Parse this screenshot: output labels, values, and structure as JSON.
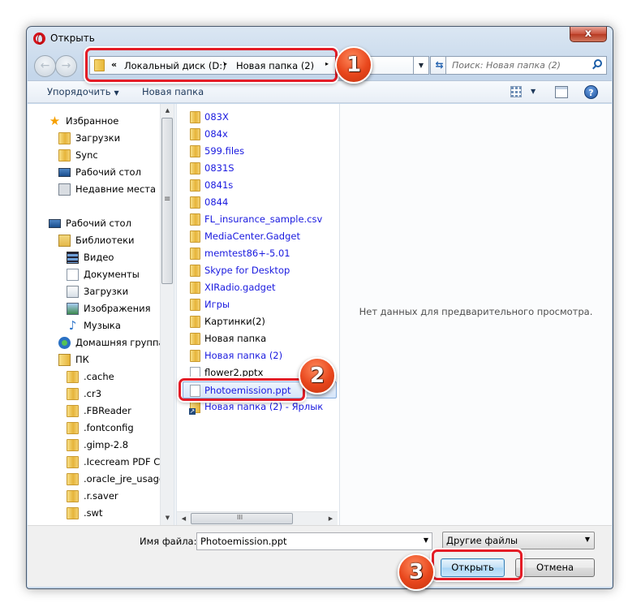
{
  "window": {
    "title": "Открыть",
    "close_label": "x"
  },
  "address_bar": {
    "overflow_chevron": "«",
    "crumbs": [
      "Локальный диск (D:)",
      "Новая папка (2)"
    ],
    "crumb_separator": "▸"
  },
  "search": {
    "placeholder": "Поиск: Новая папка (2)"
  },
  "toolbar": {
    "organize_label": "Упорядочить",
    "new_folder_label": "Новая папка",
    "dropdown_glyph": "▼",
    "help_glyph": "?"
  },
  "nav_pane": {
    "items": [
      {
        "label": "Избранное",
        "icon": "star-icon"
      },
      {
        "label": "Загрузки",
        "icon": "downloads-folder-icon"
      },
      {
        "label": "Sync",
        "icon": "folder-icon"
      },
      {
        "label": "Рабочий стол",
        "icon": "desktop-icon"
      },
      {
        "label": "Недавние места",
        "icon": "recent-places-icon"
      },
      {
        "label": "Рабочий стол",
        "icon": "desktop-icon"
      },
      {
        "label": "Библиотеки",
        "icon": "libraries-icon"
      },
      {
        "label": "Видео",
        "icon": "video-library-icon"
      },
      {
        "label": "Документы",
        "icon": "documents-library-icon"
      },
      {
        "label": "Загрузки",
        "icon": "downloads-library-icon"
      },
      {
        "label": "Изображения",
        "icon": "pictures-library-icon"
      },
      {
        "label": "Музыка",
        "icon": "music-library-icon"
      },
      {
        "label": "Домашняя группа",
        "icon": "homegroup-icon"
      },
      {
        "label": "ПК",
        "icon": "user-folder-icon"
      },
      {
        "label": ".cache",
        "icon": "folder-icon"
      },
      {
        "label": ".cr3",
        "icon": "folder-icon"
      },
      {
        "label": ".FBReader",
        "icon": "folder-icon"
      },
      {
        "label": ".fontconfig",
        "icon": "folder-icon"
      },
      {
        "label": ".gimp-2.8",
        "icon": "folder-icon"
      },
      {
        "label": ".Icecream PDF Co",
        "icon": "folder-icon"
      },
      {
        "label": ".oracle_jre_usage",
        "icon": "folder-icon"
      },
      {
        "label": ".r.saver",
        "icon": "folder-icon"
      },
      {
        "label": ".swt",
        "icon": "folder-icon"
      }
    ]
  },
  "file_list": {
    "items": [
      {
        "name": "083X",
        "type": "folder",
        "color": "blue"
      },
      {
        "name": "084x",
        "type": "folder",
        "color": "blue"
      },
      {
        "name": "599.files",
        "type": "folder",
        "color": "blue"
      },
      {
        "name": "0831S",
        "type": "folder",
        "color": "blue"
      },
      {
        "name": "0841s",
        "type": "folder",
        "color": "blue"
      },
      {
        "name": "0844",
        "type": "folder",
        "color": "blue"
      },
      {
        "name": "FL_insurance_sample.csv",
        "type": "folder",
        "color": "blue"
      },
      {
        "name": "MediaCenter.Gadget",
        "type": "folder",
        "color": "blue"
      },
      {
        "name": "memtest86+-5.01",
        "type": "folder",
        "color": "blue"
      },
      {
        "name": "Skype for Desktop",
        "type": "folder",
        "color": "blue"
      },
      {
        "name": "XIRadio.gadget",
        "type": "folder",
        "color": "blue"
      },
      {
        "name": "Игры",
        "type": "folder",
        "color": "blue"
      },
      {
        "name": "Картинки(2)",
        "type": "folder",
        "color": "black"
      },
      {
        "name": "Новая папка",
        "type": "folder",
        "color": "black"
      },
      {
        "name": "Новая папка (2)",
        "type": "folder",
        "color": "blue"
      },
      {
        "name": "flower2.pptx",
        "type": "file",
        "color": "black"
      },
      {
        "name": "Photoemission.ppt",
        "type": "file",
        "color": "blue",
        "selected": true
      },
      {
        "name": "Новая папка (2) - Ярлык",
        "type": "shortcut",
        "color": "blue"
      }
    ]
  },
  "preview": {
    "message": "Нет данных для предварительного просмотра."
  },
  "bottom": {
    "filename_label": "Имя файла:",
    "filename_value": "Photoemission.ppt",
    "filetype_value": "Другие файлы",
    "open_label": "Открыть",
    "cancel_label": "Отмена"
  },
  "annotations": {
    "callouts": [
      "1",
      "2",
      "3"
    ],
    "highlight_color": "#e41c26",
    "callout_color": "#e8461c"
  }
}
